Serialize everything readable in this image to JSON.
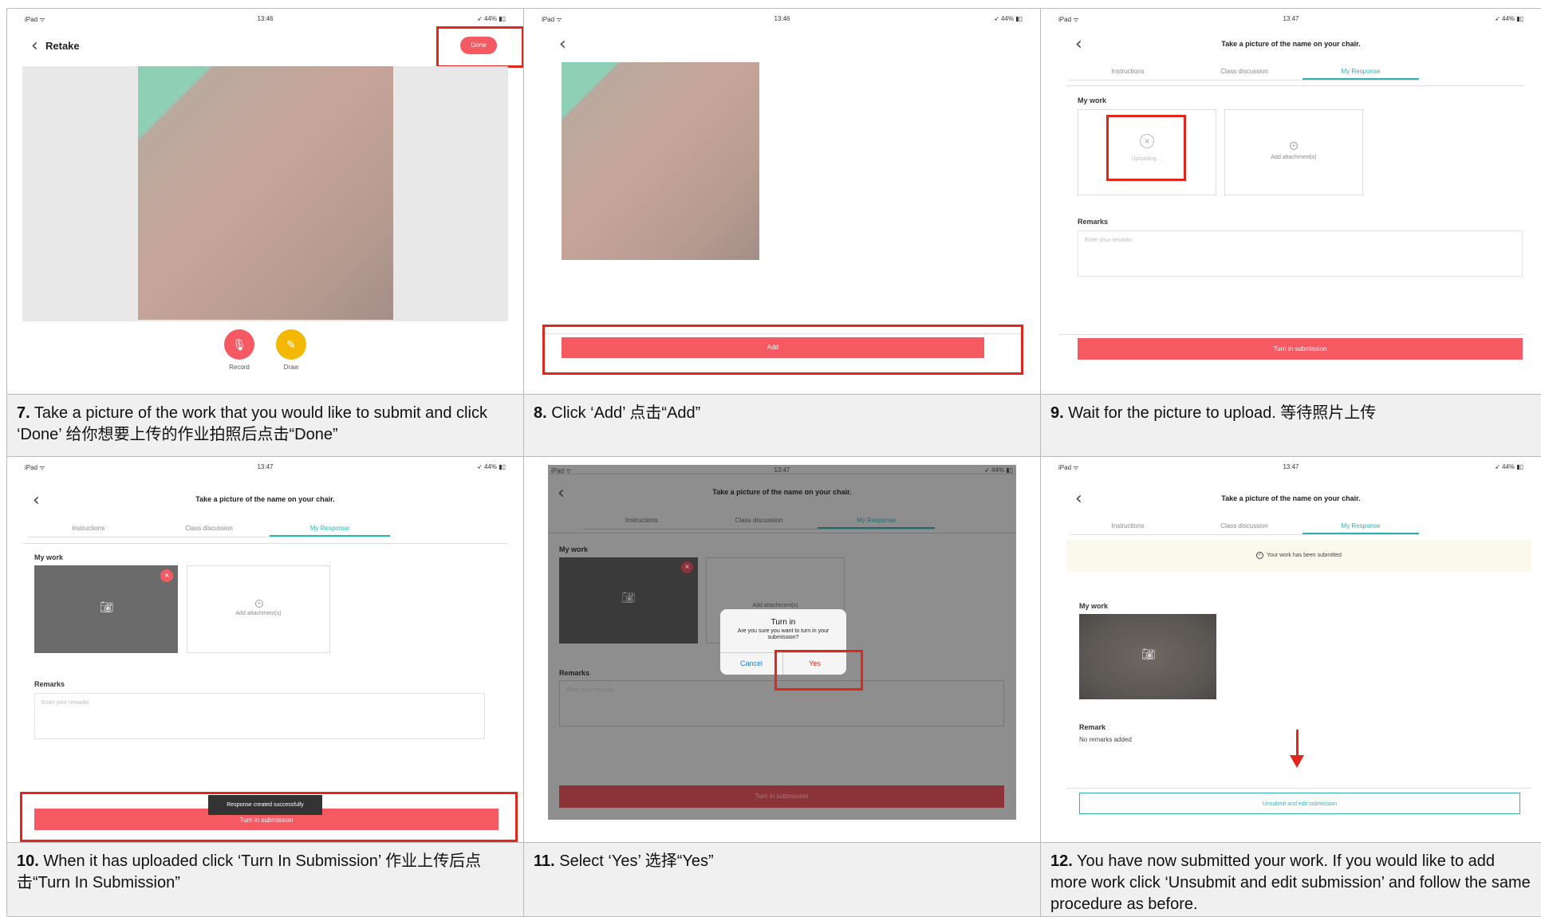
{
  "status": {
    "device": "iPad ᯤ",
    "battery": "➶ 44% ▮▯"
  },
  "panel7": {
    "time": "13:46",
    "back_label": "Retake",
    "done_label": "Done",
    "record_label": "Record",
    "draw_label": "Draw"
  },
  "panel8": {
    "time": "13:46",
    "add_label": "Add"
  },
  "assignment": {
    "title": "Take a picture of the name on your chair.",
    "tabs": [
      "Instructions",
      "Class discussion",
      "My Response"
    ],
    "my_work": "My work",
    "remarks": "Remarks",
    "remarks_placeholder": "Enter your remarks",
    "add_attachment": "Add attachment(s)",
    "turn_in": "Turn in submission"
  },
  "panel9": {
    "time": "13:47",
    "uploading": "Uploading ..."
  },
  "panel10": {
    "time": "13:47",
    "toast": "Response created successfully"
  },
  "panel11": {
    "time": "13:47",
    "dialog_title": "Turn in",
    "dialog_msg": "Are you sure you want to turn in your submission?",
    "cancel": "Cancel",
    "yes": "Yes"
  },
  "panel12": {
    "time": "13:47",
    "submitted_msg": "Your work has been submitted",
    "remark_label": "Remark",
    "no_remarks": "No remarks added",
    "unsubmit": "Unsubmit and edit submission"
  },
  "captions": {
    "c7_num": "7.",
    "c7_text": " Take a picture of the work that you would like to submit and click ‘Done’ 给你想要上传的作业拍照后点击“Done”",
    "c8_num": "8.",
    "c8_text": " Click ‘Add’ 点击“Add”",
    "c9_num": "9.",
    "c9_text": " Wait for the picture to upload. 等待照片上传",
    "c10_num": "10.",
    "c10_text": " When it has uploaded click ‘Turn In Submission’ 作业上传后点击“Turn In Submission”",
    "c11_num": "11.",
    "c11_text": " Select ‘Yes’ 选择“Yes”",
    "c12_num": "12.",
    "c12_text": " You have now submitted your work. If you would like to add more work click ‘Unsubmit and edit submission’ and follow the same procedure as before."
  },
  "colors": {
    "accent": "#2eb3b3",
    "primary": "#f55a63",
    "highlight": "#e3261b"
  }
}
